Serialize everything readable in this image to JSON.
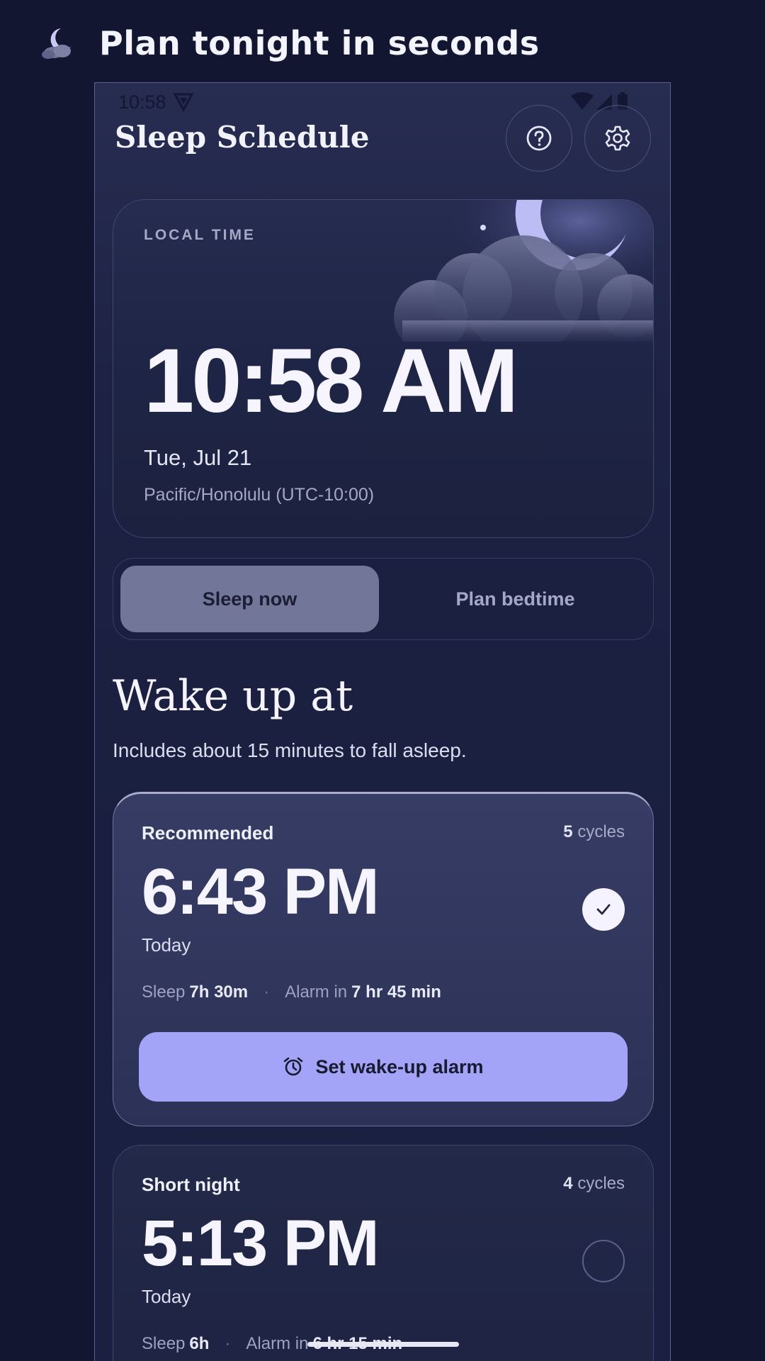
{
  "banner": {
    "logo_icon": "moon-cloud-icon",
    "title": "Plan tonight in seconds"
  },
  "status_bar": {
    "time": "10:58",
    "icons": [
      "vpn-icon",
      "wifi-icon",
      "signal-icon",
      "battery-icon"
    ]
  },
  "header": {
    "title": "Sleep Schedule",
    "help_icon": "help-icon",
    "settings_icon": "gear-icon"
  },
  "local_time_card": {
    "label": "LOCAL TIME",
    "time": "10:58 AM",
    "date": "Tue, Jul 21",
    "timezone": "Pacific/Honolulu (UTC-10:00)"
  },
  "mode_toggle": {
    "options": [
      "Sleep now",
      "Plan bedtime"
    ],
    "selected": "Sleep now"
  },
  "wake_section": {
    "title": "Wake up at",
    "subtitle": "Includes about 15 minutes to fall asleep."
  },
  "options": [
    {
      "label": "Recommended",
      "cycles_count": "5",
      "cycles_word": "cycles",
      "time": "6:43 PM",
      "day": "Today",
      "sleep_label": "Sleep",
      "sleep_value": "7h 30m",
      "alarm_label": "Alarm in",
      "alarm_value": "7 hr 45 min",
      "selected": true,
      "button_label": "Set wake-up alarm"
    },
    {
      "label": "Short night",
      "cycles_count": "4",
      "cycles_word": "cycles",
      "time": "5:13 PM",
      "day": "Today",
      "sleep_label": "Sleep",
      "sleep_value": "6h",
      "alarm_label": "Alarm in",
      "alarm_value": "6 hr 15 min",
      "selected": false
    }
  ],
  "colors": {
    "background": "#121630",
    "accent": "#a3a4f8",
    "segment_active": "#727699"
  }
}
